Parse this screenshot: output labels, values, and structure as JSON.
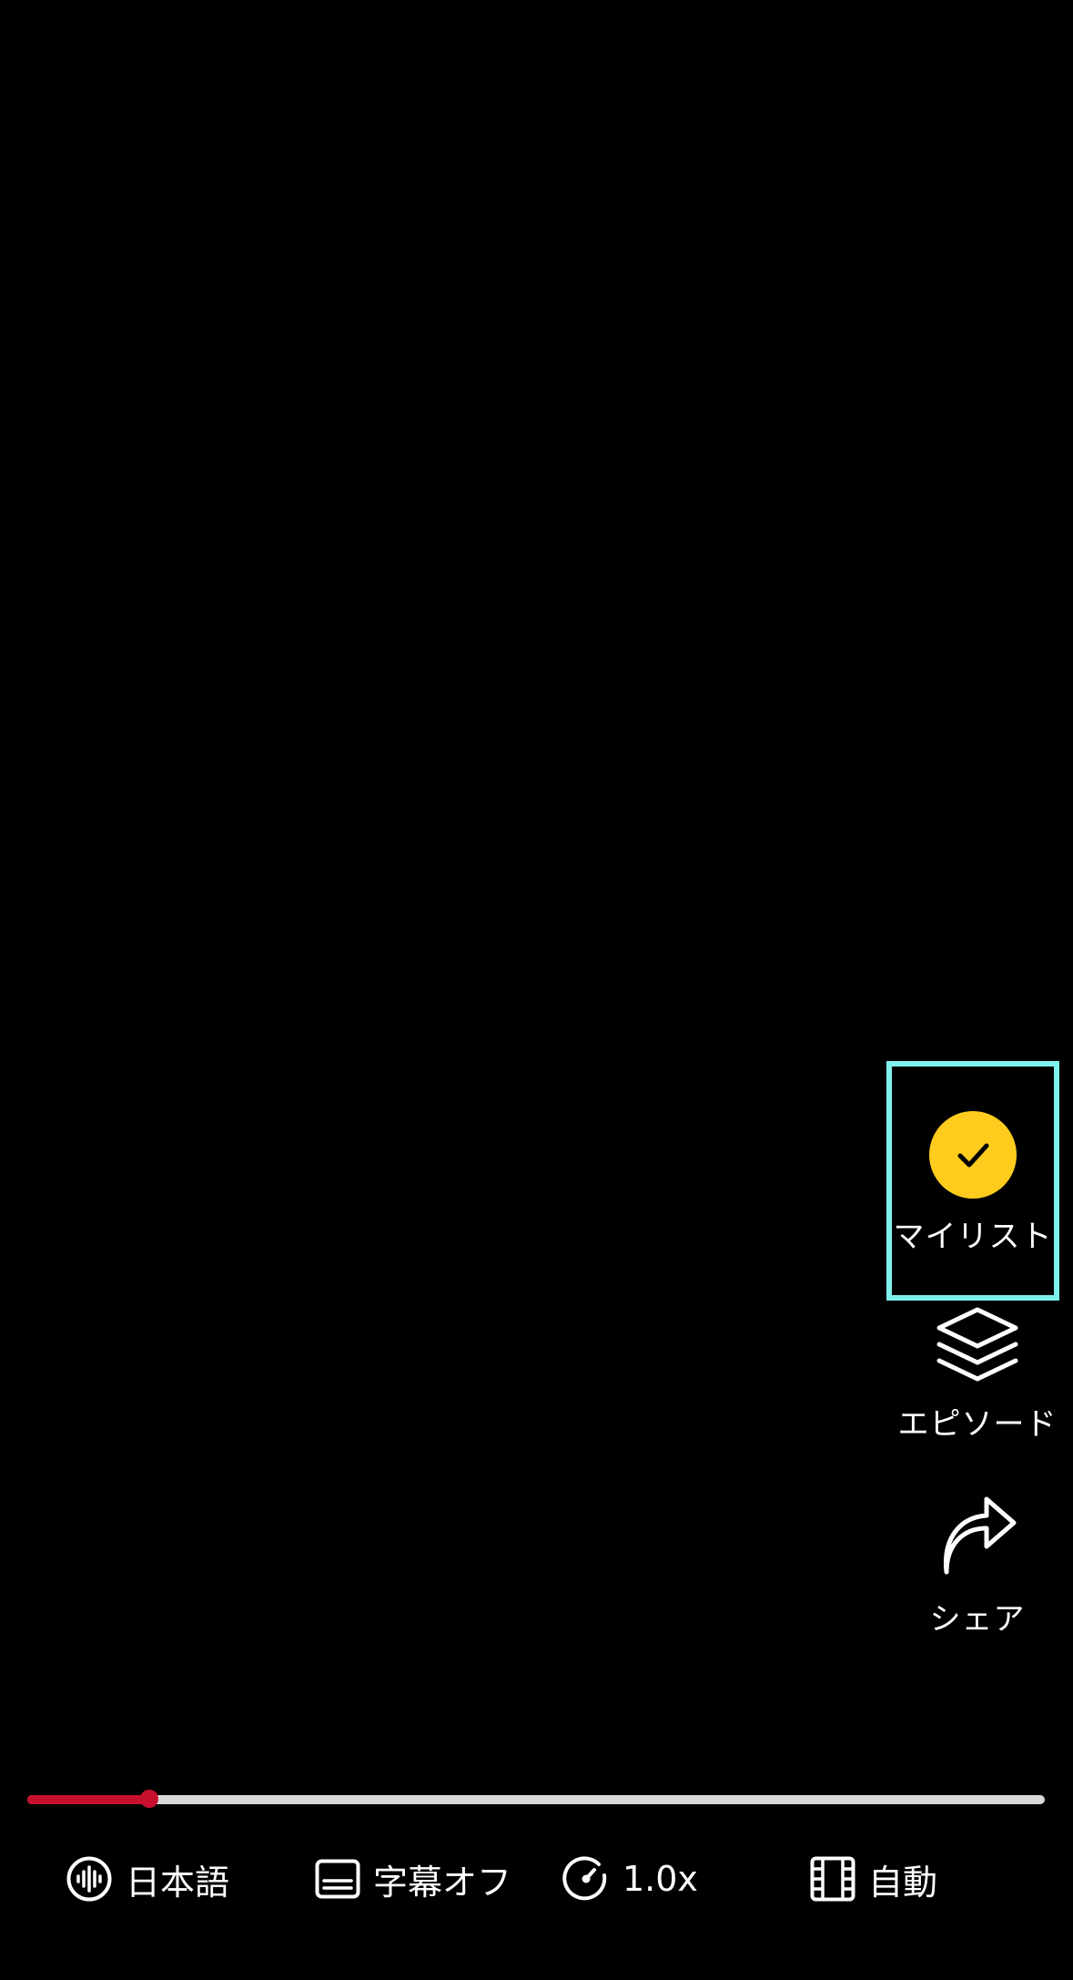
{
  "actions": {
    "mylist_label": "マイリスト",
    "episodes_label": "エピソード",
    "share_label": "シェア"
  },
  "player": {
    "progress": 0.12,
    "audio_label": "日本語",
    "subtitles_label": "字幕オフ",
    "speed_label": "1.0x",
    "quality_label": "自動"
  },
  "colors": {
    "background": "#000000",
    "mylist_check": "#ffcc1e",
    "progress_fill": "#c8102e",
    "progress_track": "#d9d9d9",
    "highlight_border": "#7ff0ee"
  },
  "icons": {
    "mylist": "checkmark-circle-icon",
    "episodes": "layers-icon",
    "share": "share-arrow-icon",
    "audio": "audio-waveform-icon",
    "subtitles": "subtitles-icon",
    "speed": "speed-gauge-icon",
    "quality": "film-icon"
  }
}
